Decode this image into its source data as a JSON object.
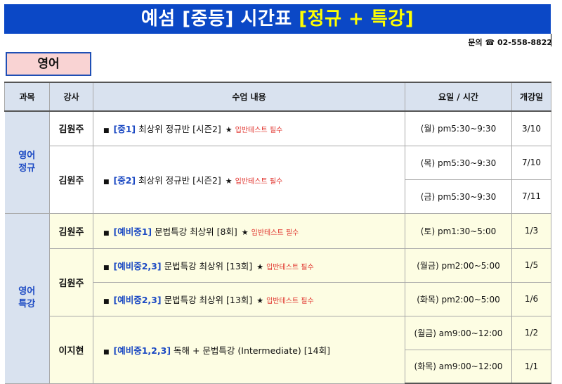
{
  "banner": {
    "title_main": "예섬 [중등] 시간표",
    "title_highlight": "[정규 + 특강]"
  },
  "contact": {
    "label": "문의",
    "phone": "☎ 02-558-8822"
  },
  "subject_tab": "영어",
  "table": {
    "headers": [
      "과목",
      "강사",
      "수업 내용",
      "요일 / 시간",
      "개강일"
    ],
    "categories": {
      "regular": "영어 정규",
      "special": "영어 특강"
    },
    "bullet": "■",
    "star": "★",
    "note": "입반테스트 필수",
    "courses": [
      {
        "teacher": "김원주",
        "code": "[중1]",
        "desc": "최상위 정규반 [시즌2]",
        "note": true,
        "schedule": [
          {
            "time": "(월) pm5:30~9:30",
            "start": "3/10"
          }
        ]
      },
      {
        "teacher": "김원주",
        "code": "[중2]",
        "desc": "최상위 정규반 [시즌2]",
        "note": true,
        "schedule": [
          {
            "time": "(목) pm5:30~9:30",
            "start": "7/10"
          },
          {
            "time": "(금) pm5:30~9:30",
            "start": "7/11"
          }
        ]
      },
      {
        "teacher": "김원주",
        "code": "[예비중1]",
        "desc": "문법특강 최상위 [8회]",
        "note": true,
        "schedule": [
          {
            "time": "(토) pm1:30~5:00",
            "start": "1/3"
          }
        ]
      },
      {
        "teacher": "김원주",
        "code": "[예비중2,3]",
        "desc": "문법특강 최상위 [13회]",
        "note": true,
        "schedule": [
          {
            "time": "(월금) pm2:00~5:00",
            "start": "1/5"
          }
        ]
      },
      {
        "teacher": "김원주",
        "code": "[예비중2,3]",
        "desc": "문법특강 최상위 [13회]",
        "note": true,
        "schedule": [
          {
            "time": "(화목) pm2:00~5:00",
            "start": "1/6"
          }
        ]
      },
      {
        "teacher": "이지현",
        "code": "[예비중1,2,3]",
        "desc": "독해 + 문법특강 (Intermediate) [14회]",
        "note": false,
        "schedule": [
          {
            "time": "(월금) am9:00~12:00",
            "start": "1/2"
          },
          {
            "time": "(화목) am9:00~12:00",
            "start": "1/1"
          }
        ]
      }
    ]
  }
}
